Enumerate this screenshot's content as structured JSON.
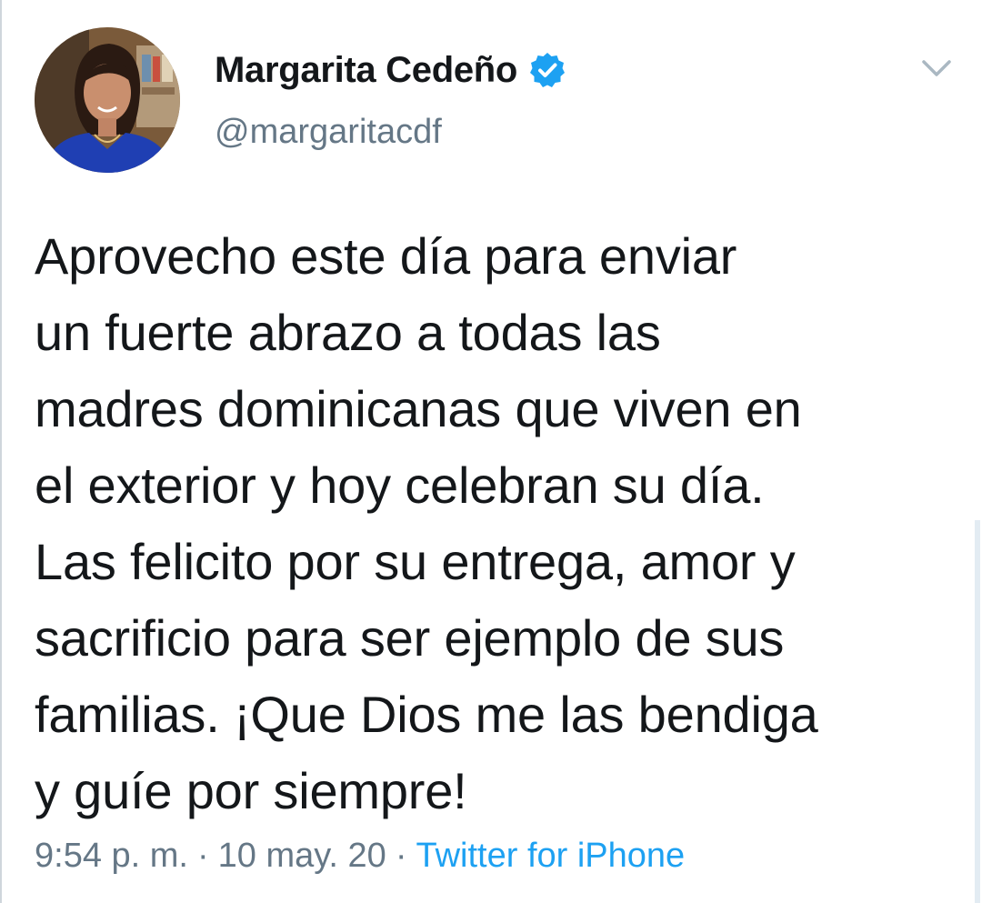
{
  "tweet": {
    "author": {
      "display_name": "Margarita Cedeño",
      "handle": "@margaritacdf",
      "verified_icon": "verified-badge-icon",
      "avatar": "profile-photo"
    },
    "menu_icon": "chevron-down-icon",
    "text_lines": [
      "Aprovecho este día para enviar",
      "un fuerte abrazo a todas las",
      "madres dominicanas que viven en",
      "el exterior y hoy celebran su día.",
      "Las felicito por su entrega, amor y",
      "sacrificio para ser ejemplo de sus",
      "familias. ¡Que Dios me las bendiga",
      "y guíe por siempre!"
    ],
    "meta": {
      "time": "9:54 p. m.",
      "separator": "·",
      "date": "10 may. 20",
      "source": "Twitter for iPhone"
    }
  },
  "colors": {
    "text": "#14171a",
    "secondary": "#657786",
    "accent": "#1da1f2"
  }
}
